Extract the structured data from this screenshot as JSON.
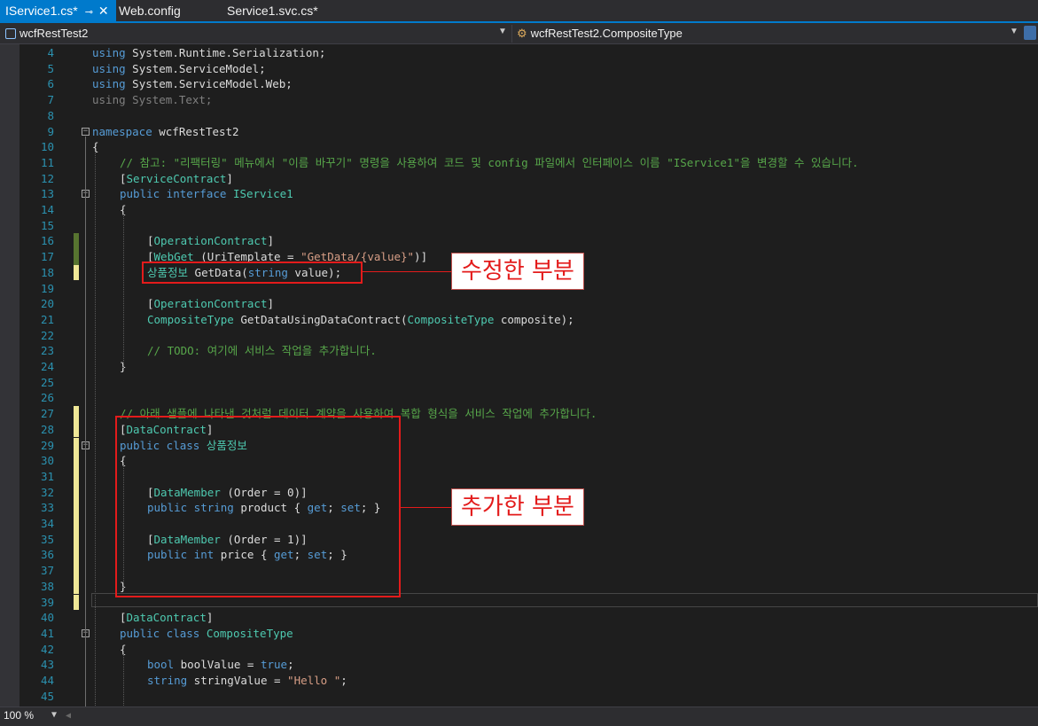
{
  "tabs": [
    {
      "label": "IService1.cs*",
      "pin": "⊸",
      "close": "✕"
    },
    {
      "label": "Web.config"
    },
    {
      "label": "Service1.svc.cs*"
    }
  ],
  "nav": {
    "project": "wcfRestTest2",
    "member": "wcfRestTest2.CompositeType"
  },
  "code_lines": [
    {
      "n": "4",
      "t": [
        [
          "kw",
          "using"
        ],
        [
          "",
          "System.Runtime.Serialization;"
        ]
      ]
    },
    {
      "n": "5",
      "t": [
        [
          "kw",
          "using"
        ],
        [
          "",
          "System.ServiceModel;"
        ]
      ]
    },
    {
      "n": "6",
      "t": [
        [
          "kw",
          "using"
        ],
        [
          "",
          "System.ServiceModel.Web;"
        ]
      ]
    },
    {
      "n": "7",
      "t": [
        [
          "dim",
          "using System.Text;"
        ]
      ]
    },
    {
      "n": "8",
      "t": []
    },
    {
      "n": "9",
      "t": [
        [
          "kw",
          "namespace"
        ],
        [
          "",
          "wcfRestTest2"
        ]
      ]
    },
    {
      "n": "10",
      "t": [
        [
          "",
          "{"
        ]
      ]
    },
    {
      "n": "11",
      "t": [
        [
          "cm",
          "// 참고: \"리팩터링\" 메뉴에서 \"이름 바꾸기\" 명령을 사용하여 코드 및 config 파일에서 인터페이스 이름 \"IService1\"을 변경할 수 있습니다."
        ]
      ]
    },
    {
      "n": "12",
      "t": [
        [
          "",
          "["
        ],
        [
          "ty",
          "ServiceContract"
        ],
        [
          "",
          "]"
        ]
      ]
    },
    {
      "n": "13",
      "t": [
        [
          "kw",
          "public"
        ],
        [
          "kw",
          "interface"
        ],
        [
          "ty",
          "IService1"
        ]
      ]
    },
    {
      "n": "14",
      "t": [
        [
          "",
          "{"
        ]
      ]
    },
    {
      "n": "15",
      "t": []
    },
    {
      "n": "16",
      "t": [
        [
          "",
          "["
        ],
        [
          "ty",
          "OperationContract"
        ],
        [
          "",
          "]"
        ]
      ]
    },
    {
      "n": "17",
      "t": [
        [
          "",
          "["
        ],
        [
          "ty",
          "WebGet"
        ],
        [
          "",
          "(UriTemplate = "
        ],
        [
          "st",
          "\"GetData/{value}\""
        ],
        [
          "",
          ")]"
        ]
      ]
    },
    {
      "n": "18",
      "t": [
        [
          "ty",
          "상품정보"
        ],
        [
          "",
          "GetData("
        ],
        [
          "kw",
          "string"
        ],
        [
          "",
          "value);"
        ]
      ]
    },
    {
      "n": "19",
      "t": []
    },
    {
      "n": "20",
      "t": [
        [
          "",
          "["
        ],
        [
          "ty",
          "OperationContract"
        ],
        [
          "",
          "]"
        ]
      ]
    },
    {
      "n": "21",
      "t": [
        [
          "ty",
          "CompositeType"
        ],
        [
          "",
          "GetDataUsingDataContract("
        ],
        [
          "ty",
          "CompositeType"
        ],
        [
          "",
          "composite);"
        ]
      ]
    },
    {
      "n": "22",
      "t": []
    },
    {
      "n": "23",
      "t": [
        [
          "cm",
          "// TODO: 여기에 서비스 작업을 추가합니다."
        ]
      ]
    },
    {
      "n": "24",
      "t": [
        [
          "",
          "}"
        ]
      ]
    },
    {
      "n": "25",
      "t": []
    },
    {
      "n": "26",
      "t": []
    },
    {
      "n": "27",
      "t": [
        [
          "cm",
          "// 아래 샘플에 나타낸 것처럼 데이터 계약을 사용하여 복합 형식을 서비스 작업에 추가합니다."
        ]
      ]
    },
    {
      "n": "28",
      "t": [
        [
          "",
          "["
        ],
        [
          "ty",
          "DataContract"
        ],
        [
          "",
          "]"
        ]
      ]
    },
    {
      "n": "29",
      "t": [
        [
          "kw",
          "public"
        ],
        [
          "kw",
          "class"
        ],
        [
          "ty",
          "상품정보"
        ]
      ]
    },
    {
      "n": "30",
      "t": [
        [
          "",
          "{"
        ]
      ]
    },
    {
      "n": "31",
      "t": []
    },
    {
      "n": "32",
      "t": [
        [
          "",
          "["
        ],
        [
          "ty",
          "DataMember"
        ],
        [
          "",
          "(Order = 0)]"
        ]
      ]
    },
    {
      "n": "33",
      "t": [
        [
          "kw",
          "public"
        ],
        [
          "kw",
          "string"
        ],
        [
          "",
          "product { "
        ],
        [
          "kw",
          "get"
        ],
        [
          "",
          "; "
        ],
        [
          "kw",
          "set"
        ],
        [
          "",
          "; }"
        ]
      ]
    },
    {
      "n": "34",
      "t": []
    },
    {
      "n": "35",
      "t": [
        [
          "",
          "["
        ],
        [
          "ty",
          "DataMember"
        ],
        [
          "",
          "(Order = 1)]"
        ]
      ]
    },
    {
      "n": "36",
      "t": [
        [
          "kw",
          "public"
        ],
        [
          "kw",
          "int"
        ],
        [
          "",
          "price { "
        ],
        [
          "kw",
          "get"
        ],
        [
          "",
          "; "
        ],
        [
          "kw",
          "set"
        ],
        [
          "",
          "; }"
        ]
      ]
    },
    {
      "n": "37",
      "t": []
    },
    {
      "n": "38",
      "t": [
        [
          "",
          "}"
        ]
      ]
    },
    {
      "n": "39",
      "t": []
    },
    {
      "n": "40",
      "t": [
        [
          "",
          "["
        ],
        [
          "ty",
          "DataContract"
        ],
        [
          "",
          "]"
        ]
      ]
    },
    {
      "n": "41",
      "t": [
        [
          "kw",
          "public"
        ],
        [
          "kw",
          "class"
        ],
        [
          "ty",
          "CompositeType"
        ]
      ]
    },
    {
      "n": "42",
      "t": [
        [
          "",
          "{"
        ]
      ]
    },
    {
      "n": "43",
      "t": [
        [
          "kw",
          "bool"
        ],
        [
          "",
          "boolValue = "
        ],
        [
          "kw",
          "true"
        ],
        [
          "",
          ";"
        ]
      ]
    },
    {
      "n": "44",
      "t": [
        [
          "kw",
          "string"
        ],
        [
          "",
          "stringValue = "
        ],
        [
          "st",
          "\"Hello \""
        ],
        [
          "",
          ";"
        ]
      ]
    },
    {
      "n": "45",
      "t": []
    }
  ],
  "annotations": {
    "modified_label": "수정한 부분",
    "added_label": "추가한 부분"
  },
  "status": {
    "zoom": "100 %"
  },
  "colors": {
    "accent": "#007acc",
    "highlight_red": "#e31b1b",
    "keyword": "#569cd6",
    "type": "#4ec9b0",
    "comment": "#57a64a",
    "string": "#d69d85",
    "line_number": "#2b91af"
  }
}
